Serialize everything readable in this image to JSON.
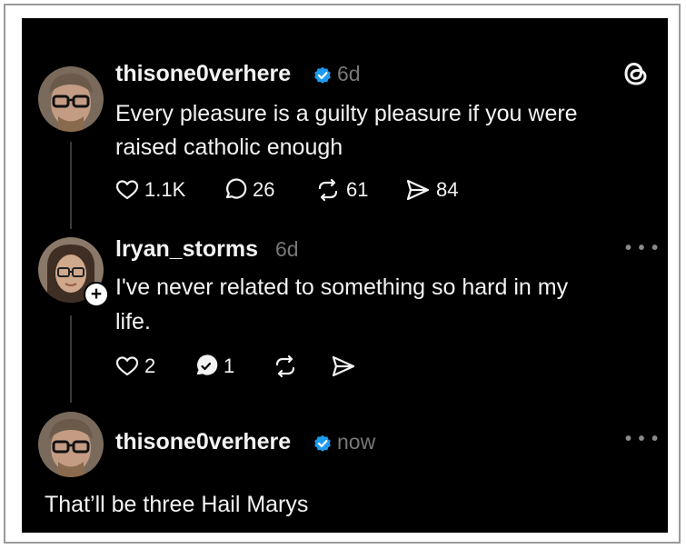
{
  "posts": [
    {
      "username": "thisone0verhere",
      "verified": true,
      "time": "6d",
      "text_lines": [
        "Every pleasure is a guilty pleasure if you were",
        "raised catholic enough"
      ],
      "actions": {
        "likes": "1.1K",
        "replies": "26",
        "reposts": "61",
        "shares": "84"
      }
    },
    {
      "username": "lryan_storms",
      "verified": false,
      "time": "6d",
      "text_lines": [
        "I've never related to something so hard in my",
        "life."
      ],
      "actions": {
        "likes": "2",
        "replies": "1"
      }
    },
    {
      "username": "thisone0verhere",
      "verified": true,
      "time": "now",
      "text": "That’ll be three Hail Marys"
    }
  ],
  "icons": {
    "threads_logo": "threads-logo-icon",
    "like": "heart-icon",
    "reply": "speech-bubble-icon",
    "repost": "repost-icon",
    "share": "send-icon",
    "more": "more-options-icon",
    "follow": "plus-icon"
  },
  "colors": {
    "background": "#000000",
    "text": "#f3f3f3",
    "muted": "#777777",
    "verified": "#1d9bf0"
  }
}
